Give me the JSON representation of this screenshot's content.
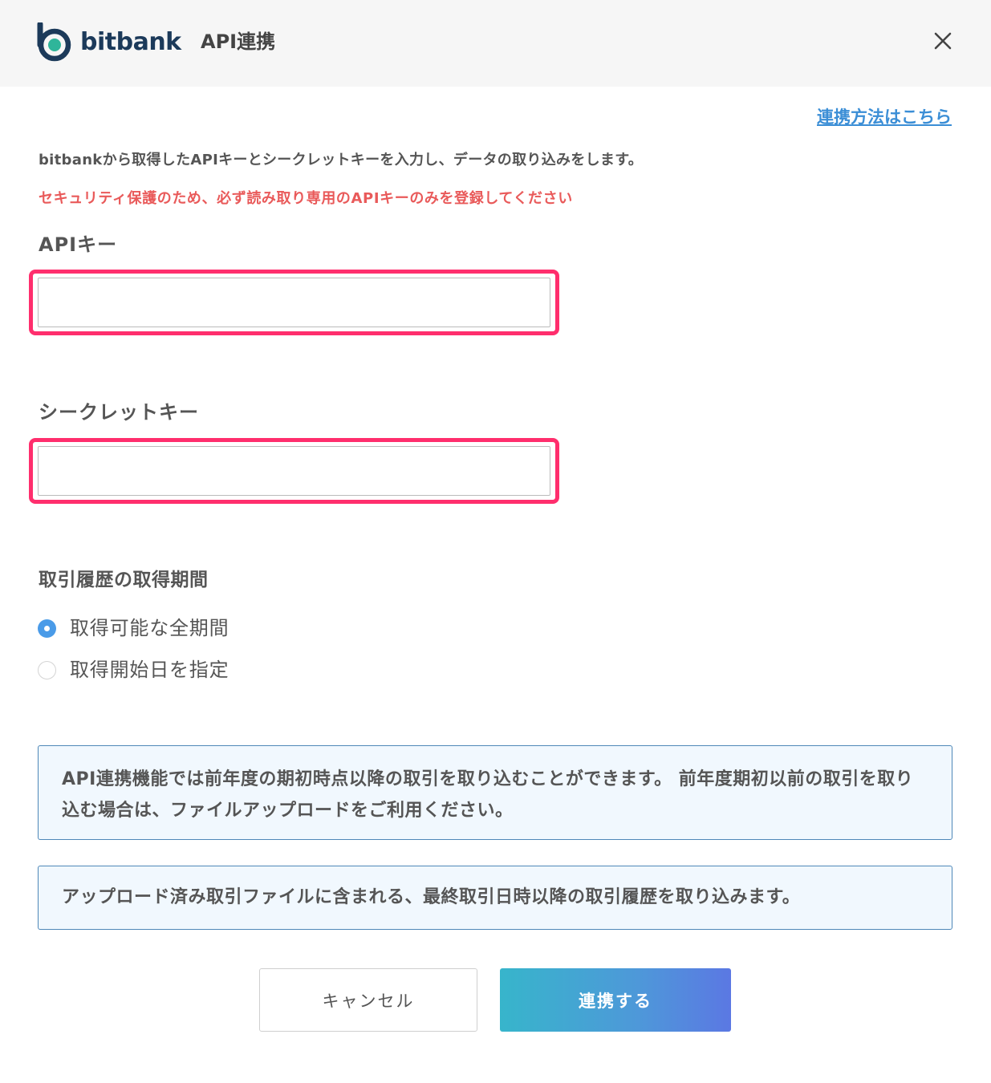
{
  "header": {
    "brand": "bitbank",
    "title": "API連携",
    "close_icon": "close-icon",
    "brand_colors": {
      "ring": "#1c3a5a",
      "dot": "#2fb59a"
    }
  },
  "help_link": "連携方法はこちら",
  "description": "bitbankから取得したAPIキーとシークレットキーを入力し、データの取り込みをします。",
  "warning": "セキュリティ保護のため、必ず読み取り専用のAPIキーのみを登録してください",
  "api_key": {
    "label": "APIキー",
    "value": "",
    "placeholder": ""
  },
  "secret_key": {
    "label": "シークレットキー",
    "value": "",
    "placeholder": ""
  },
  "period": {
    "label": "取引履歴の取得期間",
    "options": [
      {
        "label": "取得可能な全期間",
        "selected": true
      },
      {
        "label": "取得開始日を指定",
        "selected": false
      }
    ]
  },
  "notices": [
    "API連携機能では前年度の期初時点以降の取引を取り込むことができます。 前年度期初以前の取引を取り込む場合は、ファイルアップロードをご利用ください。",
    "アップロード済み取引ファイルに含まれる、最終取引日時以降の取引履歴を取り込みます。"
  ],
  "buttons": {
    "cancel": "キャンセル",
    "submit": "連携する"
  },
  "colors": {
    "accent": "#4a9be8",
    "warning": "#e95a5a",
    "highlight_border": "#ff2e6d",
    "link": "#3b8ed6"
  }
}
